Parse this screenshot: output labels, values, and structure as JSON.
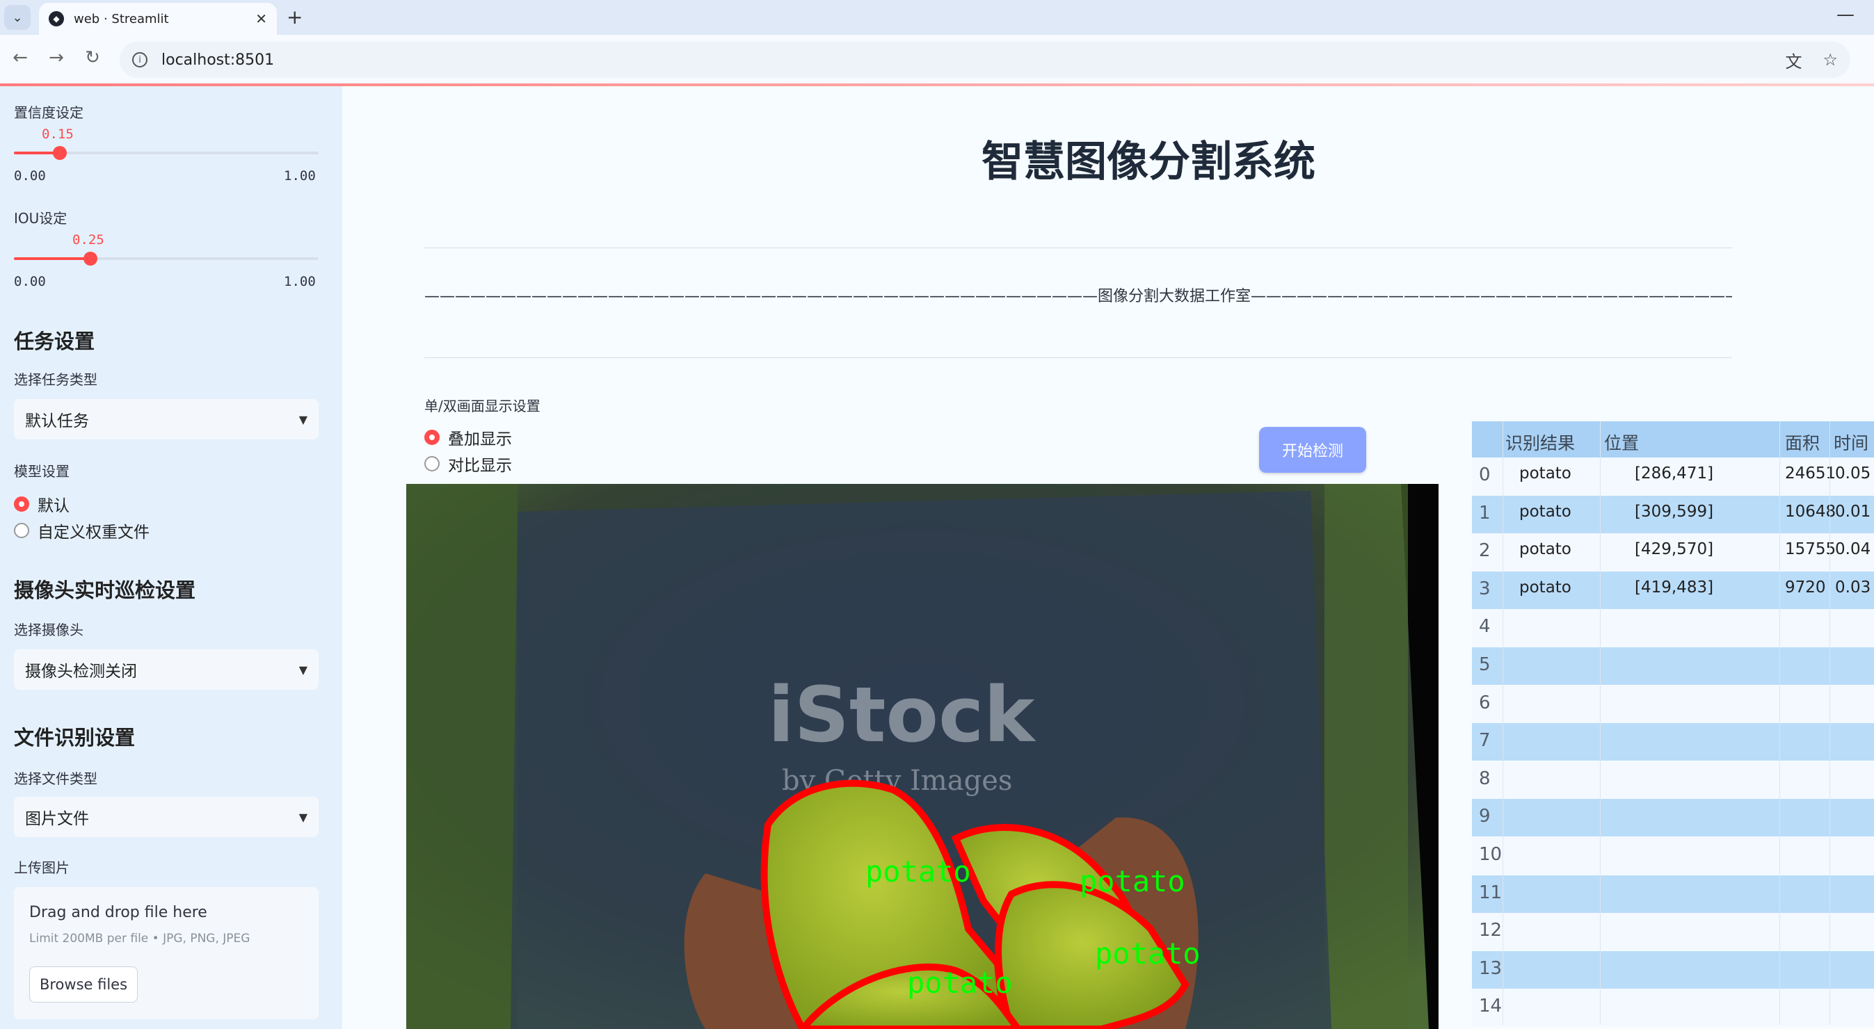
{
  "browser": {
    "tab_title": "web · Streamlit",
    "url": "localhost:8501"
  },
  "sidebar": {
    "confidence": {
      "label": "置信度设定",
      "value": "0.15",
      "fraction": 0.15,
      "min": "0.00",
      "max": "1.00"
    },
    "iou": {
      "label": "IOU设定",
      "value": "0.25",
      "fraction": 0.25,
      "min": "0.00",
      "max": "1.00"
    },
    "task_heading": "任务设置",
    "task_type_label": "选择任务类型",
    "task_type_value": "默认任务",
    "model_label": "模型设置",
    "model_options": [
      "默认",
      "自定义权重文件"
    ],
    "camera_heading": "摄像头实时巡检设置",
    "camera_label": "选择摄像头",
    "camera_value": "摄像头检测关闭",
    "file_heading": "文件识别设置",
    "file_type_label": "选择文件类型",
    "file_type_value": "图片文件",
    "upload_label": "上传图片",
    "upload_title": "Drag and drop file here",
    "upload_limit": "Limit 200MB per file • JPG, PNG, JPEG",
    "browse_button": "Browse files"
  },
  "main": {
    "title": "智慧图像分割系统",
    "banner": "————————————————————————————————————————————图像分割大数据工作室————————————————————————————————————————————",
    "display_label": "单/双画面显示设置",
    "display_options": [
      "叠加显示",
      "对比显示"
    ],
    "start_button": "开始检测",
    "image": {
      "watermark": "iStock",
      "watermark_sub": "by Getty Images",
      "detection_label": "potato"
    }
  },
  "table": {
    "columns": [
      "识别结果",
      "位置",
      "面积",
      "时间"
    ],
    "rows": [
      {
        "index": "0",
        "result": "potato",
        "position": "[286,471]",
        "area": "24651",
        "time": "0.05"
      },
      {
        "index": "1",
        "result": "potato",
        "position": "[309,599]",
        "area": "10648",
        "time": "0.01"
      },
      {
        "index": "2",
        "result": "potato",
        "position": "[429,570]",
        "area": "15755",
        "time": "0.04"
      },
      {
        "index": "3",
        "result": "potato",
        "position": "[419,483]",
        "area": "9720",
        "time": "0.03"
      },
      {
        "index": "4"
      },
      {
        "index": "5"
      },
      {
        "index": "6"
      },
      {
        "index": "7"
      },
      {
        "index": "8"
      },
      {
        "index": "9"
      },
      {
        "index": "10"
      },
      {
        "index": "11"
      },
      {
        "index": "12"
      },
      {
        "index": "13"
      },
      {
        "index": "14"
      }
    ]
  },
  "colors": {
    "accent": "#ff4b4b",
    "sidebar_bg": "#e4f1fd",
    "button_bg": "#8aa3ff",
    "table_header": "#a9d1f5",
    "mask_outline": "#ff0000",
    "mask_label": "#00ff00"
  }
}
